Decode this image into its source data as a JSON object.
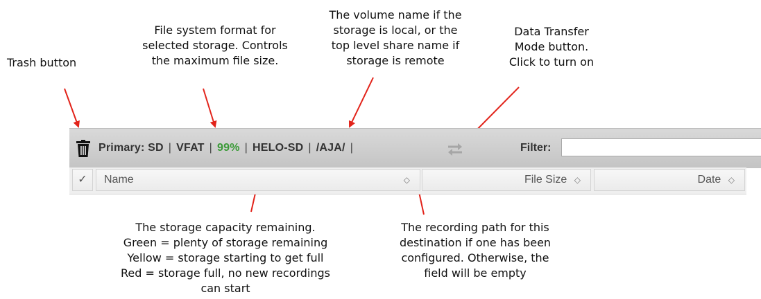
{
  "callouts": {
    "trash": "Trash button",
    "format": "File system format for\nselected storage. Controls\nthe maximum file size.",
    "volume": "The volume name if the\nstorage is local, or the\ntop level share name if\nstorage is remote",
    "transfer": "Data Transfer\nMode button.\nClick to turn on",
    "capacity": "The storage capacity remaining.\nGreen = plenty of storage remaining\nYellow = storage starting to get full\nRed = storage full, no new recordings\ncan start",
    "path": "The recording path for this\ndestination if one has been\nconfigured. Otherwise, the\nfield will be empty"
  },
  "toolbar": {
    "storage_label": "Primary: SD",
    "separator": "|",
    "format": "VFAT",
    "capacity": "99%",
    "volume": "HELO-SD",
    "path": "/AJA/",
    "filter_label": "Filter:",
    "filter_value": ""
  },
  "table_headers": {
    "check": "✓",
    "name": "Name",
    "file_size": "File Size",
    "date": "Date",
    "sort_glyph": "◇"
  },
  "colors": {
    "capacity_ok": "#3a9a37",
    "arrow": "#e2231a",
    "toolbar_bg": "#cfcfcf"
  },
  "icons": {
    "trash": "trash-icon",
    "transfer": "transfer-arrows-icon",
    "sort": "sort-icon"
  }
}
